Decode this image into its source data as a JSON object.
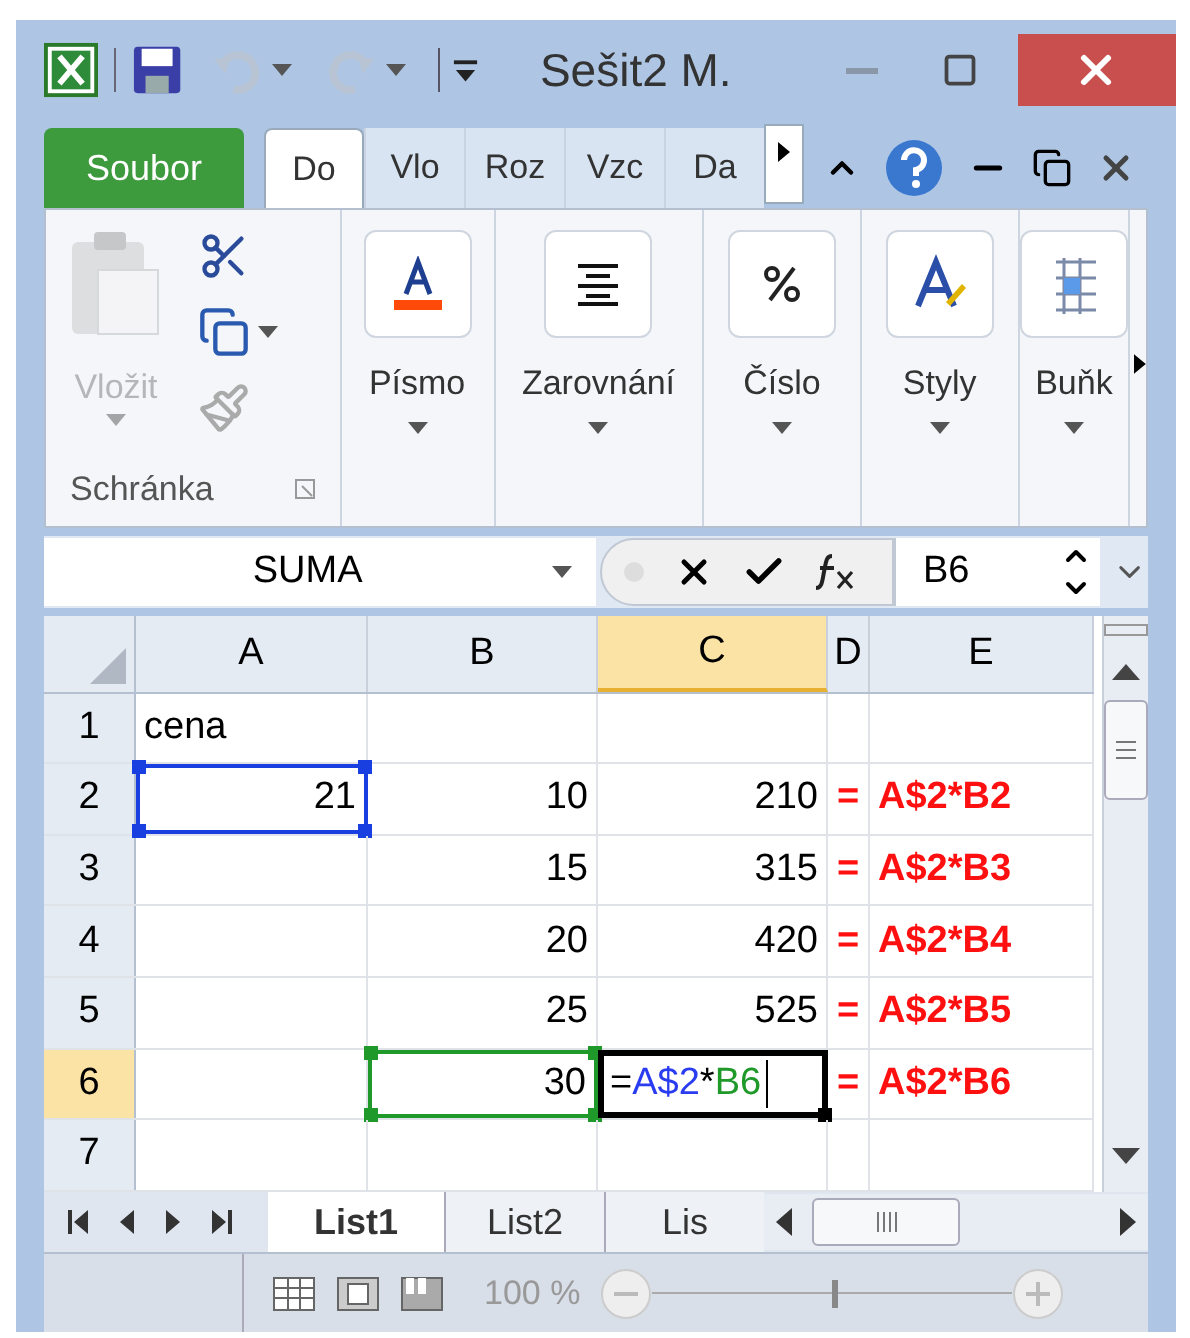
{
  "window": {
    "title": "Sešit2 M."
  },
  "ribbon_tabs": [
    {
      "label": "Soubor",
      "kind": "file",
      "selected": false
    },
    {
      "label": "Do",
      "kind": "tab",
      "selected": true
    },
    {
      "label": "Vlo",
      "kind": "tab",
      "selected": false
    },
    {
      "label": "Roz",
      "kind": "tab",
      "selected": false
    },
    {
      "label": "Vzc",
      "kind": "tab",
      "selected": false
    },
    {
      "label": "Da",
      "kind": "tab",
      "selected": false
    }
  ],
  "clipboard": {
    "paste": "Vložit",
    "paste_disabled": true,
    "group": "Schránka"
  },
  "ribbon_groups": [
    {
      "label": "Písmo",
      "kind": "font"
    },
    {
      "label": "Zarovnání",
      "kind": "align"
    },
    {
      "label": "Číslo",
      "kind": "number"
    },
    {
      "label": "Styly",
      "kind": "styles"
    },
    {
      "label": "Buňk",
      "kind": "cells"
    }
  ],
  "formula_bar": {
    "name_box": "SUMA",
    "formula": "B6"
  },
  "grid": {
    "columns": [
      {
        "label": "A",
        "selected": false
      },
      {
        "label": "B",
        "selected": false
      },
      {
        "label": "C",
        "selected": true
      },
      {
        "label": "D",
        "selected": false
      },
      {
        "label": "E",
        "selected": false
      }
    ],
    "rows": [
      {
        "label": "1",
        "selected": false,
        "cells": [
          {
            "text": "cena",
            "kind": "label"
          },
          {},
          {},
          {},
          {}
        ]
      },
      {
        "label": "2",
        "selected": false,
        "cells": [
          {
            "text": "21",
            "kind": "number",
            "color": "#1a3fe0"
          },
          {
            "text": "10",
            "kind": "number"
          },
          {
            "text": "210",
            "kind": "number"
          },
          {
            "text": "=",
            "kind": "note"
          },
          {
            "text": "A$2*B2",
            "kind": "note"
          }
        ]
      },
      {
        "label": "3",
        "selected": false,
        "cells": [
          {},
          {
            "text": "15",
            "kind": "number"
          },
          {
            "text": "315",
            "kind": "number"
          },
          {
            "text": "=",
            "kind": "note"
          },
          {
            "text": "A$2*B3",
            "kind": "note"
          }
        ]
      },
      {
        "label": "4",
        "selected": false,
        "cells": [
          {},
          {
            "text": "20",
            "kind": "number"
          },
          {
            "text": "420",
            "kind": "number"
          },
          {
            "text": "=",
            "kind": "note"
          },
          {
            "text": "A$2*B4",
            "kind": "note"
          }
        ]
      },
      {
        "label": "5",
        "selected": false,
        "cells": [
          {},
          {
            "text": "25",
            "kind": "number"
          },
          {
            "text": "525",
            "kind": "number"
          },
          {
            "text": "=",
            "kind": "note"
          },
          {
            "text": "A$2*B5",
            "kind": "note"
          }
        ]
      },
      {
        "label": "6",
        "selected": true,
        "cells": [
          {},
          {
            "text": "30",
            "kind": "number",
            "color": "#1f9a2a"
          },
          {
            "kind": "edit",
            "active": true,
            "parts": [
              {
                "text": "=",
                "color": "#000000"
              },
              {
                "text": "A$2",
                "color": "#2a3cf0"
              },
              {
                "text": "*",
                "color": "#000000"
              },
              {
                "text": "B6",
                "color": "#1f9a2a"
              }
            ]
          },
          {
            "text": "=",
            "kind": "note"
          },
          {
            "text": "A$2*B6",
            "kind": "note"
          }
        ]
      },
      {
        "label": "7",
        "selected": false,
        "cells": [
          {},
          {},
          {},
          {},
          {}
        ]
      }
    ]
  },
  "sheet_tabs": [
    {
      "label": "List1",
      "selected": true
    },
    {
      "label": "List2",
      "selected": false
    },
    {
      "label": "Lis",
      "selected": false
    }
  ],
  "status_bar": {
    "zoom": "100 %",
    "level": 0.5
  }
}
